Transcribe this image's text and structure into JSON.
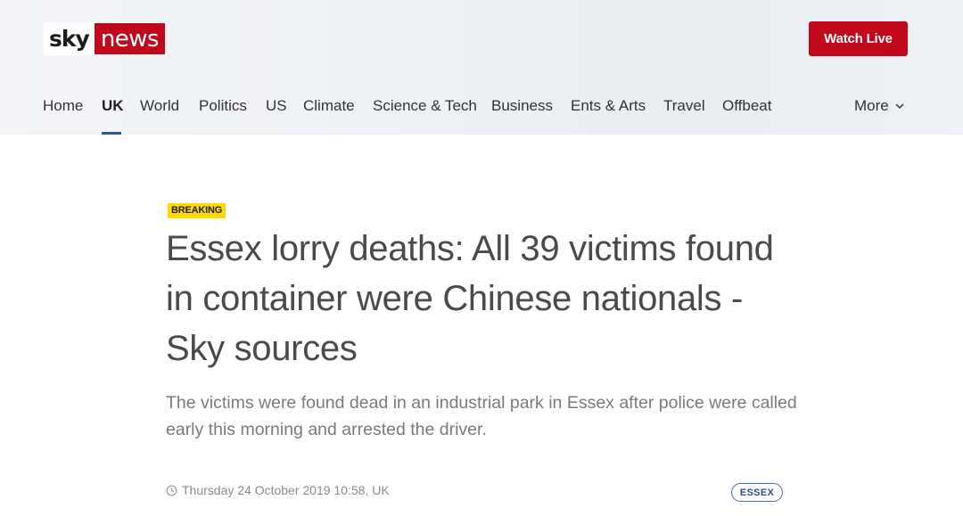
{
  "brand": {
    "sky": "sky",
    "news": "news",
    "accent": "#c0091b"
  },
  "header": {
    "watch_live": "Watch Live"
  },
  "nav": {
    "items": [
      {
        "label": "Home",
        "active": false
      },
      {
        "label": "UK",
        "active": true
      },
      {
        "label": "World",
        "active": false
      },
      {
        "label": "Politics",
        "active": false
      },
      {
        "label": "US",
        "active": false
      },
      {
        "label": "Climate",
        "active": false
      },
      {
        "label": "Science & Tech",
        "active": false
      },
      {
        "label": "Business",
        "active": false
      },
      {
        "label": "Ents & Arts",
        "active": false
      },
      {
        "label": "Travel",
        "active": false
      },
      {
        "label": "Offbeat",
        "active": false
      }
    ],
    "more": "More",
    "more_icon": "chevron-down-icon"
  },
  "article": {
    "badge": "BREAKING",
    "headline": "Essex lorry deaths: All 39 victims found in container were Chinese nationals - Sky sources",
    "standfirst": "The victims were found dead in an industrial park in Essex after police were called early this morning and arrested the driver.",
    "timestamp": "Thursday 24 October 2019 10:58, UK",
    "timestamp_icon": "clock-icon",
    "tag": "ESSEX"
  }
}
